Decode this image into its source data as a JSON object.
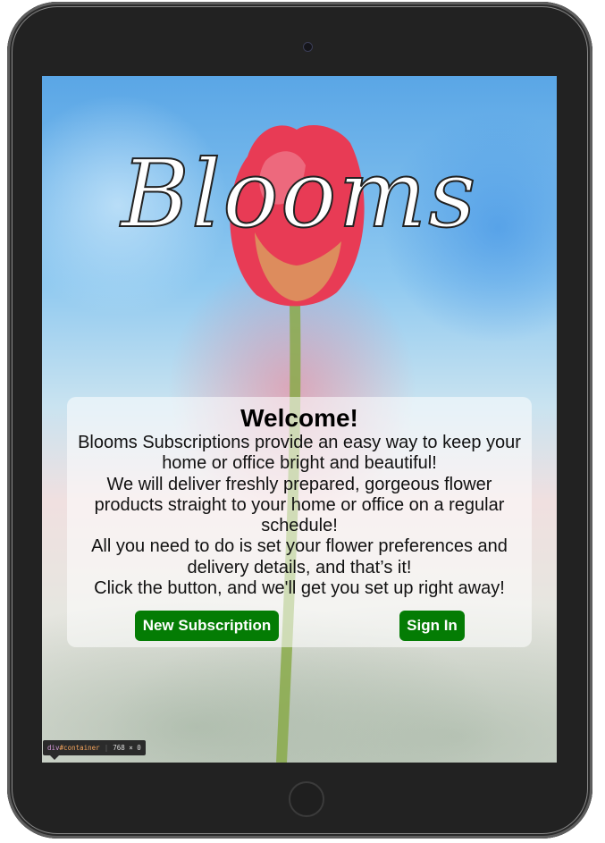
{
  "brand": {
    "logo_text": "Blooms"
  },
  "welcome": {
    "heading": "Welcome!",
    "lines": [
      "Blooms Subscriptions provide an easy way to keep your",
      "home or office bright and beautiful!",
      "We will deliver freshly prepared, gorgeous flower",
      "products straight to your home or office on a regular",
      "schedule!",
      "All you need to do is set your flower preferences and",
      "delivery details, and that’s it!",
      "Click the button, and we'll get you set up right away!"
    ]
  },
  "buttons": {
    "new_subscription": "New Subscription",
    "sign_in": "Sign In"
  },
  "devtools": {
    "element": "div",
    "id": "#container",
    "dimensions": "768 × 0"
  },
  "colors": {
    "button": "#047c04",
    "tablet_frame": "#222222",
    "card": "rgba(255,255,255,0.55)"
  },
  "icons": [
    "camera-icon",
    "home-button-icon"
  ]
}
